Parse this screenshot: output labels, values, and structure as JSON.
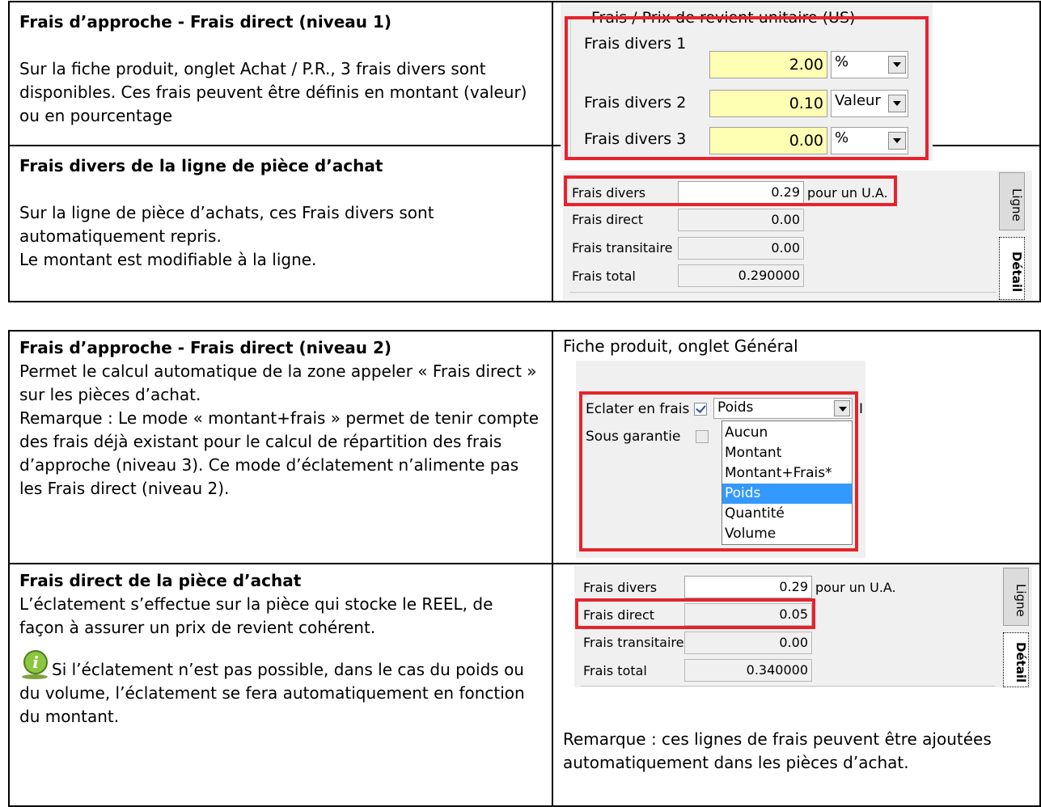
{
  "section1": {
    "row1": {
      "title": "Frais d’approche - Frais direct (niveau 1)",
      "text": "Sur la fiche produit, onglet Achat / P.R., 3 frais divers sont disponibles. Ces frais peuvent être définis en montant (valeur) ou en pourcentage",
      "panel": {
        "group_title": "Frais / Prix de revient unitaire (US)",
        "rows": [
          {
            "label": "Frais divers 1",
            "value": "2.00",
            "unit": "%"
          },
          {
            "label": "Frais divers 2",
            "value": "0.10",
            "unit": "Valeur"
          },
          {
            "label": "Frais divers 3",
            "value": "0.00",
            "unit": "%"
          }
        ]
      }
    },
    "row2": {
      "title": "Frais divers de la ligne de pièce d’achat",
      "text1": "Sur la ligne de pièce d’achats, ces Frais divers sont automatiquement repris.",
      "text2": "Le montant est modifiable à la ligne.",
      "panel": {
        "frais_divers_label": "Frais divers",
        "frais_divers_value": "0.29",
        "frais_divers_suffix": "pour un U.A.",
        "frais_direct_label": "Frais direct",
        "frais_direct_value": "0.00",
        "frais_transitaire_label": "Frais transitaire",
        "frais_transitaire_value": "0.00",
        "frais_total_label": "Frais total",
        "frais_total_value": "0.290000",
        "tab_ligne": "Ligne",
        "tab_detail": "Détail"
      }
    }
  },
  "section2": {
    "row1": {
      "title": "Frais d’approche - Frais direct (niveau 2)",
      "text": "Permet le calcul automatique de la zone appeler « Frais direct » sur les pièces d’achat.",
      "remark": "Remarque : Le mode « montant+frais » permet de tenir compte des frais déjà existant pour le calcul de répartition des frais d’approche (niveau 3). Ce mode d’éclatement n’alimente pas les Frais direct (niveau 2).",
      "caption": "Fiche produit, onglet Général",
      "panel": {
        "eclater_label": "Eclater en frais",
        "eclater_value": "Poids",
        "garantie_label": "Sous garantie",
        "options": [
          "Aucun",
          "Montant",
          "Montant+Frais*",
          "Poids",
          "Quantité",
          "Volume"
        ],
        "selected_option": "Poids",
        "cut_char": "I"
      }
    },
    "row2": {
      "title": "Frais direct de la pièce d’achat",
      "text": "L’éclatement s’effectue sur la pièce qui stocke le REEL, de façon à assurer un prix de revient cohérent.",
      "note": "Si l’éclatement n’est pas possible, dans le cas du poids ou du volume, l’éclatement se fera automatiquement en fonction du montant.",
      "remark": "Remarque : ces lignes de frais peuvent être ajoutées automatiquement dans les pièces d’achat.",
      "panel": {
        "frais_divers_label": "Frais divers",
        "frais_divers_value": "0.29",
        "frais_divers_suffix": "pour un U.A.",
        "frais_direct_label": "Frais direct",
        "frais_direct_value": "0.05",
        "frais_transitaire_label": "Frais transitaire",
        "frais_transitaire_value": "0.00",
        "frais_total_label": "Frais total",
        "frais_total_value": "0.340000",
        "tab_ligne": "Ligne",
        "tab_detail": "Détail"
      }
    }
  },
  "colors": {
    "highlight_border": "#e6232c",
    "input_yellow": "#ffffb4",
    "selection": "#3399ff"
  },
  "icons": {
    "note_icon": "info-icon"
  }
}
